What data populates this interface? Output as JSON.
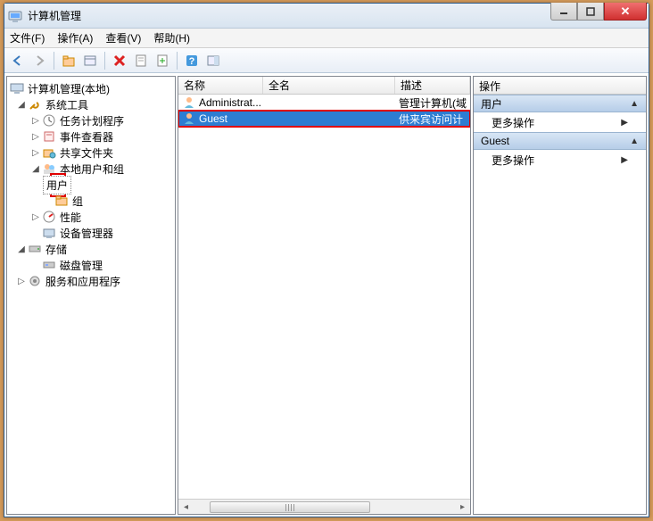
{
  "window": {
    "title": "计算机管理",
    "menu": {
      "file": "文件(F)",
      "action": "操作(A)",
      "view": "查看(V)",
      "help": "帮助(H)"
    }
  },
  "tree": {
    "root": "计算机管理(本地)",
    "system_tools": "系统工具",
    "task_scheduler": "任务计划程序",
    "event_viewer": "事件查看器",
    "shared_folders": "共享文件夹",
    "local_users_groups": "本地用户和组",
    "users": "用户",
    "groups": "组",
    "performance": "性能",
    "device_manager": "设备管理器",
    "storage": "存储",
    "disk_management": "磁盘管理",
    "services_apps": "服务和应用程序"
  },
  "list": {
    "cols": {
      "name": "名称",
      "fullname": "全名",
      "desc": "描述"
    },
    "rows": [
      {
        "name": "Administrat...",
        "fullname": "",
        "desc": "管理计算机(域"
      },
      {
        "name": "Guest",
        "fullname": "",
        "desc": "供来宾访问计"
      }
    ]
  },
  "actions": {
    "header": "操作",
    "group1": "用户",
    "item1": "更多操作",
    "group2": "Guest",
    "item2": "更多操作"
  }
}
